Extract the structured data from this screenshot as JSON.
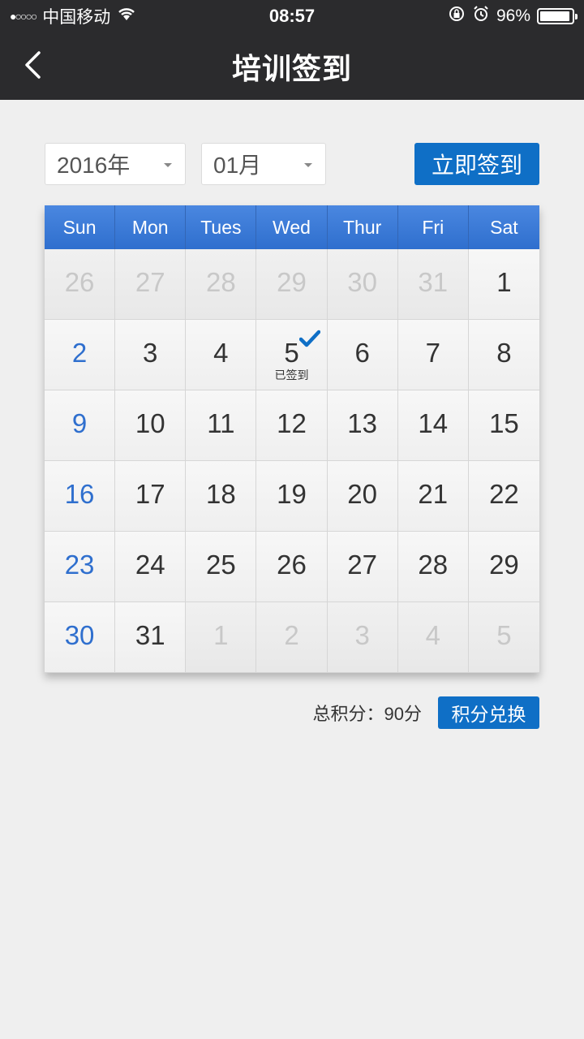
{
  "status_bar": {
    "signal": "●○○○○",
    "carrier": "中国移动",
    "time": "08:57",
    "battery_percent_text": "96%",
    "battery_level": 0.96,
    "icons": [
      "wifi-icon",
      "lock-rotation-icon",
      "alarm-icon",
      "battery-icon"
    ]
  },
  "header": {
    "title": "培训签到",
    "back_icon": "chevron-left-icon"
  },
  "controls": {
    "year": "2016年",
    "month": "01月",
    "checkin_label": "立即签到",
    "accent_color": "#0f6fc6"
  },
  "calendar": {
    "weekdays": [
      "Sun",
      "Mon",
      "Tues",
      "Wed",
      "Thur",
      "Fri",
      "Sat"
    ],
    "active_weekday": "Tues",
    "weeks": [
      [
        {
          "day": "26",
          "other": true
        },
        {
          "day": "27",
          "other": true
        },
        {
          "day": "28",
          "other": true
        },
        {
          "day": "29",
          "other": true
        },
        {
          "day": "30",
          "other": true
        },
        {
          "day": "31",
          "other": true
        },
        {
          "day": "1",
          "other": false
        }
      ],
      [
        {
          "day": "2",
          "other": false
        },
        {
          "day": "3",
          "other": false
        },
        {
          "day": "4",
          "other": false
        },
        {
          "day": "5",
          "other": false,
          "signed": true
        },
        {
          "day": "6",
          "other": false
        },
        {
          "day": "7",
          "other": false
        },
        {
          "day": "8",
          "other": false
        }
      ],
      [
        {
          "day": "9",
          "other": false
        },
        {
          "day": "10",
          "other": false
        },
        {
          "day": "11",
          "other": false
        },
        {
          "day": "12",
          "other": false
        },
        {
          "day": "13",
          "other": false
        },
        {
          "day": "14",
          "other": false
        },
        {
          "day": "15",
          "other": false
        }
      ],
      [
        {
          "day": "16",
          "other": false
        },
        {
          "day": "17",
          "other": false
        },
        {
          "day": "18",
          "other": false
        },
        {
          "day": "19",
          "other": false
        },
        {
          "day": "20",
          "other": false
        },
        {
          "day": "21",
          "other": false
        },
        {
          "day": "22",
          "other": false
        }
      ],
      [
        {
          "day": "23",
          "other": false
        },
        {
          "day": "24",
          "other": false
        },
        {
          "day": "25",
          "other": false
        },
        {
          "day": "26",
          "other": false
        },
        {
          "day": "27",
          "other": false
        },
        {
          "day": "28",
          "other": false
        },
        {
          "day": "29",
          "other": false
        }
      ],
      [
        {
          "day": "30",
          "other": false
        },
        {
          "day": "31",
          "other": false
        },
        {
          "day": "1",
          "other": true
        },
        {
          "day": "2",
          "other": true
        },
        {
          "day": "3",
          "other": true
        },
        {
          "day": "4",
          "other": true
        },
        {
          "day": "5",
          "other": true
        }
      ]
    ],
    "signed_label": "已签到",
    "signed_icon": "checkmark-icon",
    "header_color": "#2f6fce",
    "sunday_color": "#2f6fce"
  },
  "footer": {
    "points_text": "总积分：90分",
    "exchange_label": "积分兑换"
  }
}
